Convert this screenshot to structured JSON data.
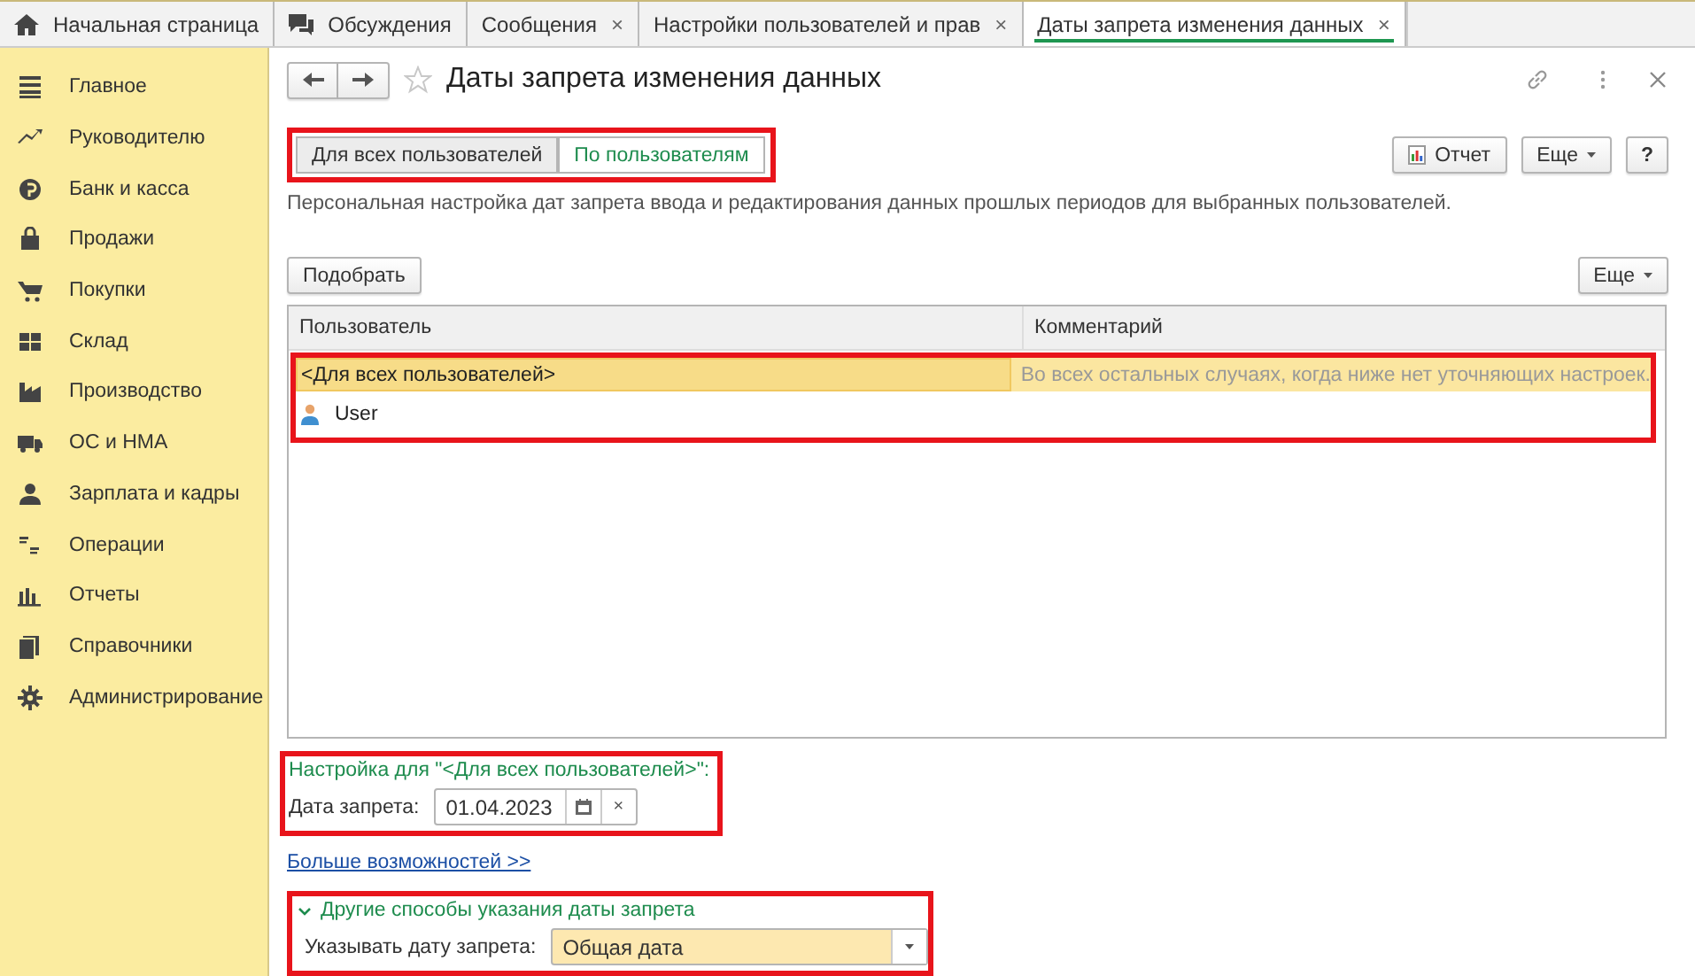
{
  "open_tabs": [
    {
      "label": "Начальная страница",
      "kind": "home",
      "selected": false
    },
    {
      "label": "Обсуждения",
      "kind": "chat",
      "selected": false
    },
    {
      "label": "Сообщения",
      "close": "×",
      "selected": false
    },
    {
      "label": "Настройки пользователей и прав",
      "close": "×",
      "selected": false
    },
    {
      "label": "Даты запрета изменения данных",
      "close": "×",
      "selected": true
    }
  ],
  "sidebar": {
    "items": [
      {
        "label": "Главное",
        "kind": "menu"
      },
      {
        "label": "Руководителю",
        "kind": "trend"
      },
      {
        "label": "Банк и касса",
        "kind": "coin"
      },
      {
        "label": "Продажи",
        "kind": "bag"
      },
      {
        "label": "Покупки",
        "kind": "cart"
      },
      {
        "label": "Склад",
        "kind": "grid"
      },
      {
        "label": "Производство",
        "kind": "factory"
      },
      {
        "label": "ОС и НМА",
        "kind": "truck"
      },
      {
        "label": "Зарплата и кадры",
        "kind": "person"
      },
      {
        "label": "Операции",
        "kind": "ledger"
      },
      {
        "label": "Отчеты",
        "kind": "bars"
      },
      {
        "label": "Справочники",
        "kind": "books"
      },
      {
        "label": "Администрирование",
        "kind": "gear"
      }
    ]
  },
  "form": {
    "title": "Даты запрета изменения данных",
    "mode_tabs": {
      "highlighted": true,
      "items": [
        {
          "label": "Для всех пользователей",
          "selected": false
        },
        {
          "label": "По пользователям",
          "selected": true
        }
      ]
    },
    "toolbar": {
      "report": "Отчет",
      "more": "Еще",
      "help": "?"
    },
    "description": "Персональная настройка дат запрета ввода и редактирования данных прошлых периодов для выбранных пользователей.",
    "table_toolbar": {
      "pick": "Подобрать",
      "more": "Еще"
    },
    "table": {
      "columns": [
        "Пользователь",
        "Комментарий"
      ],
      "rows_highlighted": true,
      "rows": [
        {
          "kind": "all",
          "user": "<Для всех пользователей>",
          "comment": "Во всех остальных случаях, когда ниже нет уточняющих настроек.",
          "selected": true
        },
        {
          "kind": "user",
          "user": "User",
          "selected": false
        }
      ]
    },
    "settings": {
      "highlighted": true,
      "heading": "Настройка для \"<Для всех пользователей>\":",
      "date_label": "Дата запрета:",
      "date_value": "01.04.2023",
      "clear": "×"
    },
    "more_link": "Больше возможностей >>",
    "other_methods": {
      "highlighted": true,
      "expanded": true,
      "title": "Другие способы указания даты запрета",
      "label": "Указывать дату запрета:",
      "value": "Общая дата"
    }
  }
}
